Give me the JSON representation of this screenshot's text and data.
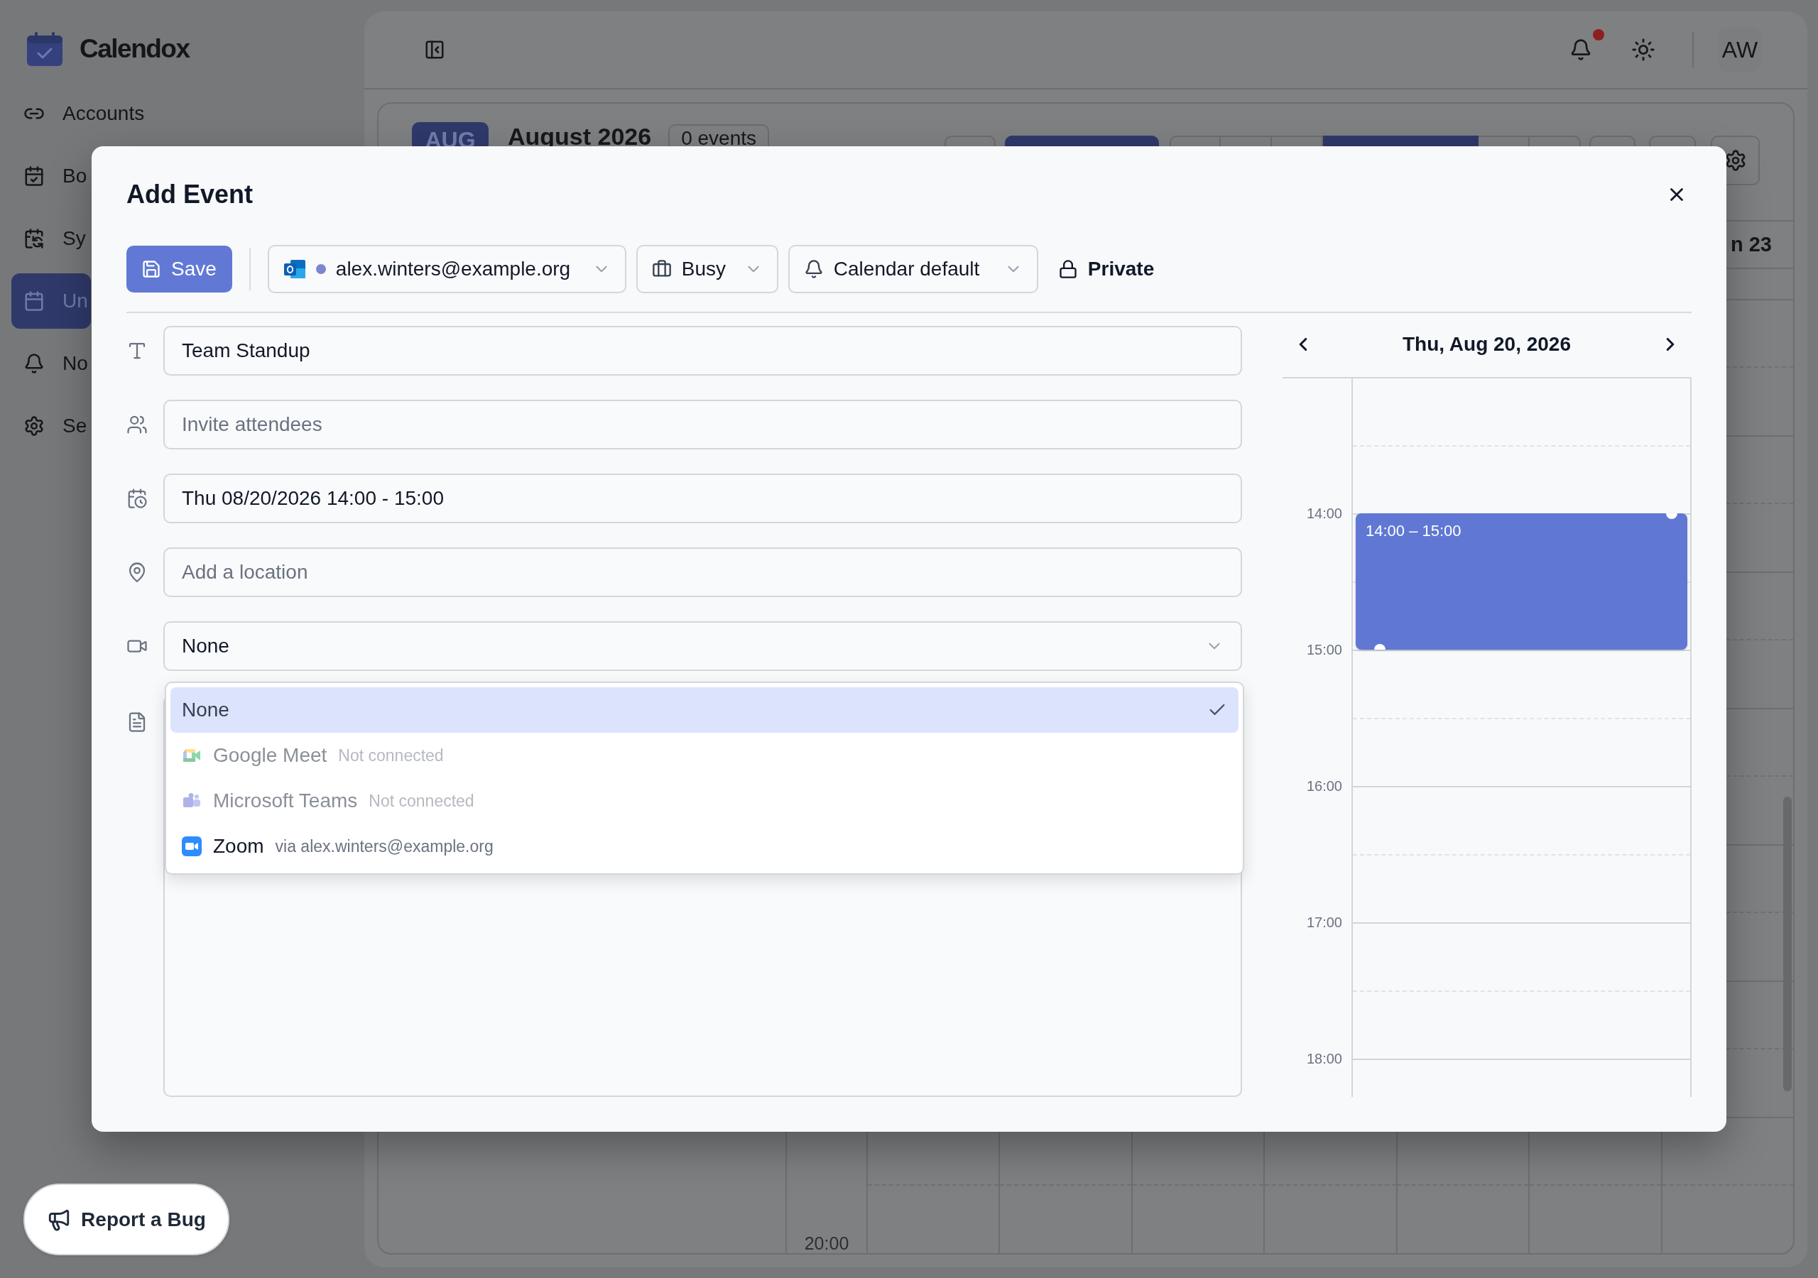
{
  "app": {
    "name": "Calendox"
  },
  "sidebar": {
    "items": [
      {
        "label": "Accounts",
        "selected": false
      },
      {
        "label": "Bo",
        "selected": false
      },
      {
        "label": "Sy",
        "selected": false
      },
      {
        "label": "Un",
        "selected": true
      },
      {
        "label": "No",
        "selected": false
      },
      {
        "label": "Se",
        "selected": false
      }
    ]
  },
  "header": {
    "unread": true,
    "avatar": "AW"
  },
  "calendar": {
    "month_badge": "AUG",
    "title": "August 2026",
    "event_count": "0 events",
    "view_buttons": [
      {
        "selected": false
      },
      {
        "selected": true
      }
    ],
    "range_buttons": [
      {
        "selected": false
      },
      {
        "selected": false
      },
      {
        "selected": false
      },
      {
        "selected": true
      },
      {
        "selected": false
      },
      {
        "selected": false
      }
    ],
    "day_header": "n 23",
    "time_label": "20:00"
  },
  "dialog": {
    "title": "Add Event",
    "toolbar": {
      "save": "Save",
      "account": {
        "email": "alex.winters@example.org",
        "color": "#7c86cf"
      },
      "availability": "Busy",
      "reminder": "Calendar default",
      "visibility": "Private"
    },
    "fields": [
      {
        "kind": "text",
        "value": "Team Standup"
      },
      {
        "kind": "text",
        "placeholder": "Invite attendees"
      },
      {
        "kind": "text",
        "value": "Thu 08/20/2026 14:00 - 15:00"
      },
      {
        "kind": "text",
        "placeholder": "Add a location"
      },
      {
        "kind": "select",
        "value": "None",
        "expanded": true,
        "options": [
          {
            "label": "None",
            "selected": true,
            "disabled": false
          },
          {
            "label": "Google Meet",
            "note": "Not connected",
            "selected": false,
            "disabled": true
          },
          {
            "label": "Microsoft Teams",
            "note": "Not connected",
            "selected": false,
            "disabled": true
          },
          {
            "label": "Zoom",
            "note": "via alex.winters@example.org",
            "selected": false,
            "disabled": false
          }
        ]
      },
      {
        "kind": "textarea"
      }
    ],
    "day_view": {
      "date": "Thu, Aug 20, 2026",
      "hours": [
        "14:00",
        "15:00",
        "16:00",
        "17:00",
        "18:00"
      ],
      "event": {
        "time": "14:00 – 15:00"
      }
    }
  },
  "report_bug": {
    "label": "Report a Bug"
  }
}
